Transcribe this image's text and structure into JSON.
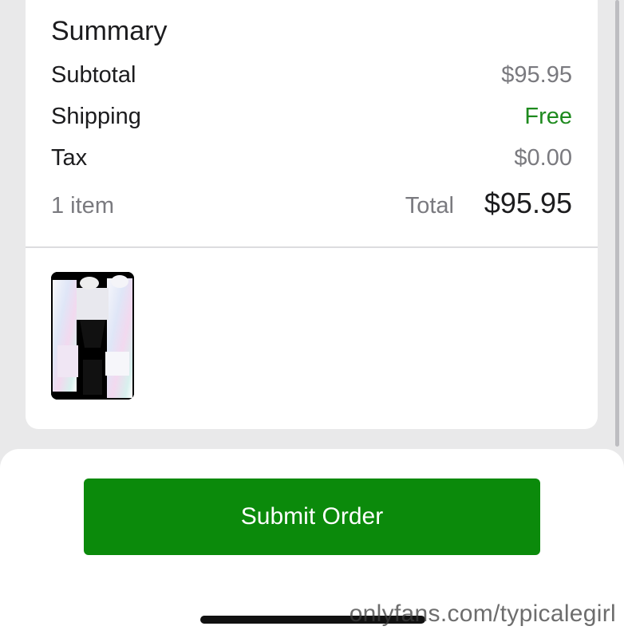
{
  "summary": {
    "title": "Summary",
    "subtotal_label": "Subtotal",
    "subtotal_value": "$95.95",
    "shipping_label": "Shipping",
    "shipping_value": "Free",
    "tax_label": "Tax",
    "tax_value": "$0.00",
    "item_count": "1 item",
    "total_label": "Total",
    "total_value": "$95.95"
  },
  "product": {
    "thumbnail_icon": "product-thumbnail"
  },
  "footer": {
    "submit_label": "Submit Order"
  },
  "watermark": "onlyfans.com/typicalegirl",
  "colors": {
    "accent_green": "#0b8a0b",
    "free_green": "#1e8a1e",
    "muted_text": "#7a7a7f",
    "background": "#e9e9ea"
  }
}
